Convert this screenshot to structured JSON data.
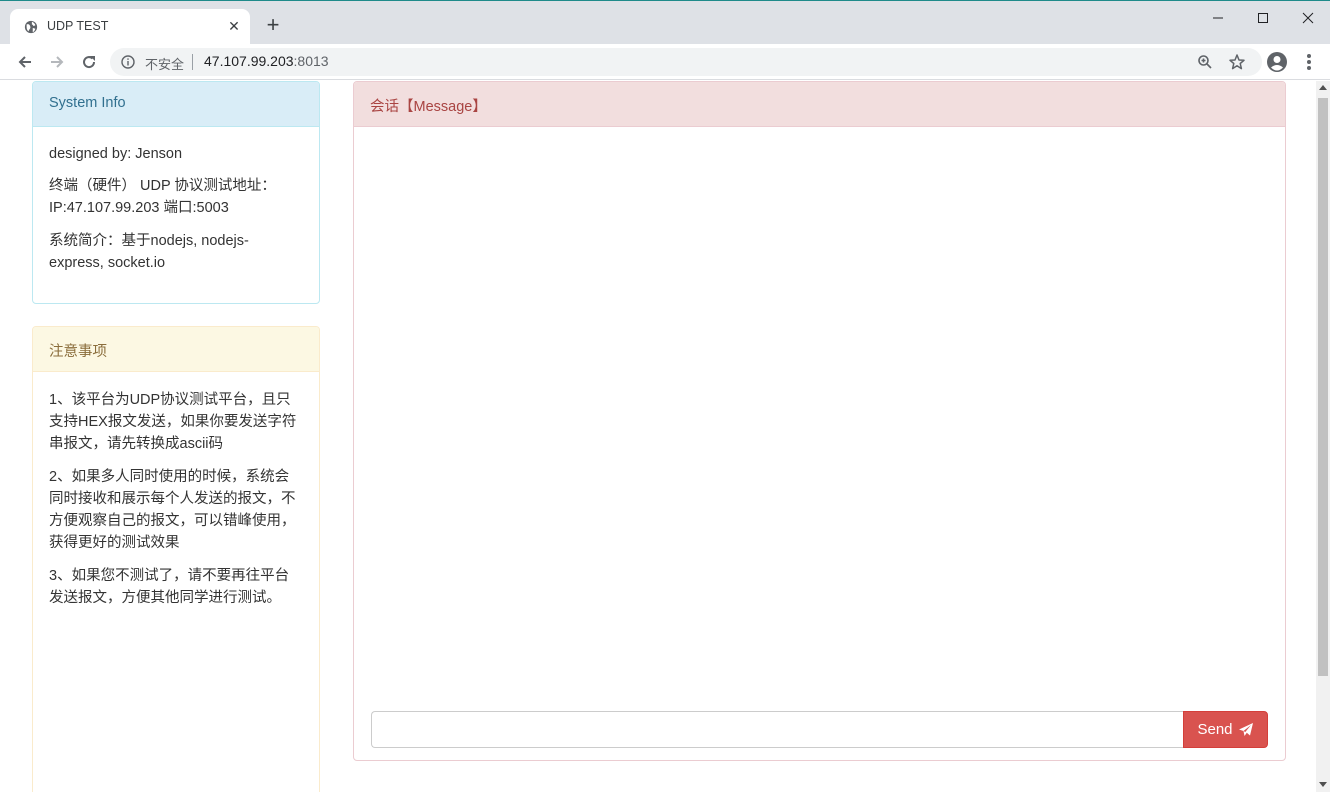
{
  "browser": {
    "tab_title": "UDP TEST",
    "tab_close": "✕",
    "new_tab": "+",
    "security_label": "不安全",
    "url_host": "47.107.99.203",
    "url_port": ":8013"
  },
  "system_info": {
    "heading": "System Info",
    "designed_by": "designed by: Jenson",
    "udp_address_line1": "终端（硬件） UDP 协议测试地址：",
    "udp_address_line2": "IP:47.107.99.203 端口:5003",
    "intro": "系统简介：基于nodejs, nodejs-express, socket.io"
  },
  "notes": {
    "heading": "注意事项",
    "items": [
      "1、该平台为UDP协议测试平台，且只支持HEX报文发送，如果你要发送字符串报文，请先转换成ascii码",
      "2、如果多人同时使用的时候，系统会同时接收和展示每个人发送的报文，不方便观察自己的报文，可以错峰使用，获得更好的测试效果",
      "3、如果您不测试了，请不要再往平台发送报文，方便其他同学进行测试。"
    ]
  },
  "message": {
    "heading": "会话【Message】",
    "input_value": "",
    "input_placeholder": "",
    "send_label": "Send"
  },
  "colors": {
    "info_bg": "#d9edf7",
    "warning_bg": "#fcf8e3",
    "danger_bg": "#f2dede",
    "send_button": "#d9534f"
  },
  "icons": {
    "tab_favicon": "globe-icon",
    "send": "paper-plane-icon"
  }
}
